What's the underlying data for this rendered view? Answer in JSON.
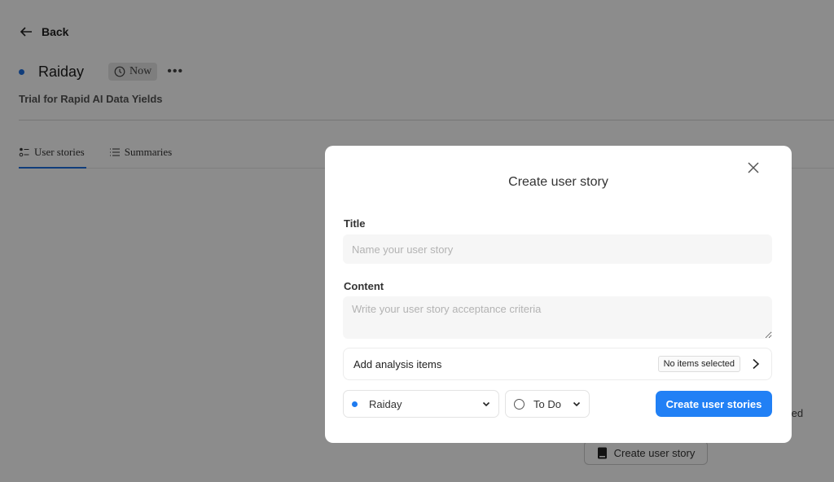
{
  "page": {
    "back_label": "Back",
    "project_name": "Raiday",
    "project_color": "#1e6fe0",
    "time_badge": "Now",
    "more_label": "•••",
    "subtitle": "Trial for Rapid AI Data Yields",
    "tabs": [
      {
        "label": "User stories",
        "icon": "list-check-icon",
        "active": true
      },
      {
        "label": "Summaries",
        "icon": "list-icon",
        "active": false
      }
    ],
    "empty_state_partial_text": "ted",
    "empty_state_button": "Create user story"
  },
  "modal": {
    "title": "Create user story",
    "title_field": {
      "label": "Title",
      "value": "",
      "placeholder": "Name your user story"
    },
    "content_field": {
      "label": "Content",
      "value": "",
      "placeholder": "Write your user story acceptance criteria"
    },
    "analysis": {
      "label": "Add analysis items",
      "badge": "No items selected"
    },
    "project_select": {
      "value": "Raiday",
      "dot_color": "#1e7bf0"
    },
    "status_select": {
      "value": "To Do"
    },
    "submit_label": "Create user stories",
    "accent_color": "#2180f5"
  }
}
